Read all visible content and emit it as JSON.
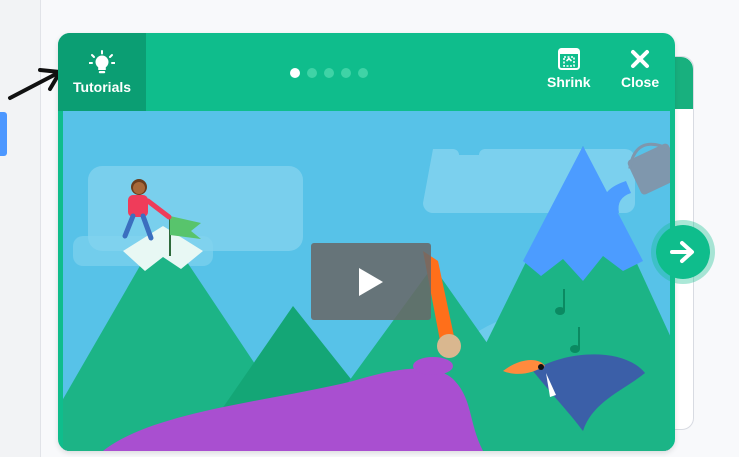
{
  "header": {
    "tutorials_label": "Tutorials",
    "shrink_label": "Shrink",
    "close_label": "Close"
  },
  "pagination": {
    "total": 5,
    "active_index": 0
  },
  "icons": {
    "tutorials": "lightbulb-icon",
    "shrink": "shrink-icon",
    "close": "close-icon",
    "play": "play-icon",
    "next": "arrow-right-icon",
    "pointer": "pointer-arrow-icon"
  },
  "colors": {
    "card_green": "#0fbd8c",
    "tutorials_bg": "#0b9e73",
    "dot_inactive": "#3fd3a6",
    "dot_active": "#ffffff",
    "sky": "#5ac3e8",
    "mountain": "#1cb486",
    "purple_paint": "#a94fd0",
    "orange_paint": "#ff6f1a"
  }
}
